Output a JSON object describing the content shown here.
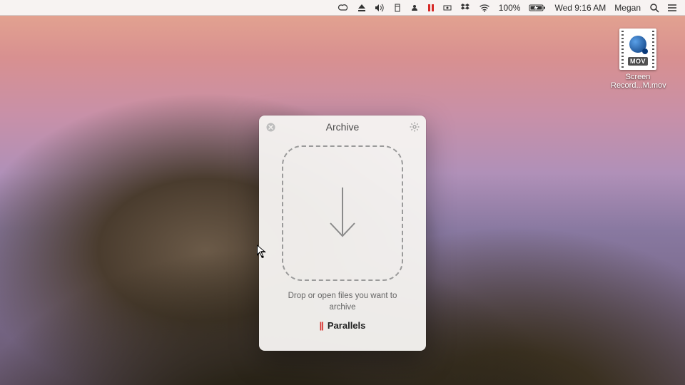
{
  "menubar": {
    "battery_pct": "100%",
    "day_time": "Wed 9:16 AM",
    "user": "Megan"
  },
  "desktop": {
    "file": {
      "ext": "MOV",
      "label": "Screen Record...M.mov"
    }
  },
  "archive": {
    "title": "Archive",
    "instructions": "Drop or open files you want to archive",
    "brand": "Parallels"
  }
}
